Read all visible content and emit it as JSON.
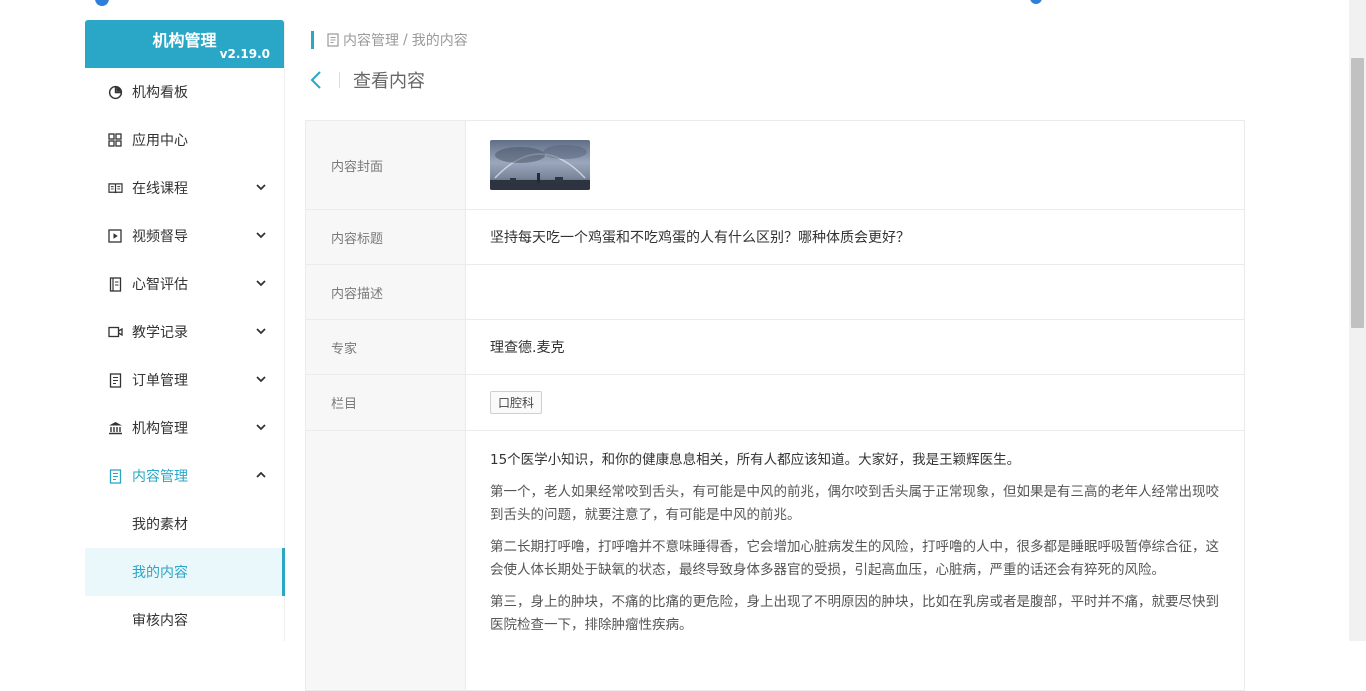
{
  "sidebar": {
    "brand_title": "机构管理",
    "brand_version": "v2.19.0",
    "items": [
      {
        "label": "机构看板",
        "icon": "pie-chart-icon",
        "has_children": false
      },
      {
        "label": "应用中心",
        "icon": "grid-icon",
        "has_children": false
      },
      {
        "label": "在线课程",
        "icon": "book-icon",
        "has_children": true
      },
      {
        "label": "视频督导",
        "icon": "play-icon",
        "has_children": true
      },
      {
        "label": "心智评估",
        "icon": "notebook-icon",
        "has_children": true
      },
      {
        "label": "教学记录",
        "icon": "video-camera-icon",
        "has_children": true
      },
      {
        "label": "订单管理",
        "icon": "document-icon",
        "has_children": true
      },
      {
        "label": "机构管理",
        "icon": "bank-icon",
        "has_children": true
      },
      {
        "label": "内容管理",
        "icon": "document-icon",
        "has_children": true,
        "expanded": true
      }
    ],
    "subitems": [
      {
        "label": "我的素材"
      },
      {
        "label": "我的内容",
        "selected": true
      },
      {
        "label": "审核内容"
      }
    ]
  },
  "breadcrumb": {
    "parent": "内容管理",
    "separator": "/",
    "current": "我的内容"
  },
  "page": {
    "title": "查看内容"
  },
  "detail": {
    "cover_label": "内容封面",
    "title_label": "内容标题",
    "title_value": "坚持每天吃一个鸡蛋和不吃鸡蛋的人有什么区别？哪种体质会更好？",
    "desc_label": "内容描述",
    "desc_value": "",
    "expert_label": "专家",
    "expert_value": "理查德.麦克",
    "column_label": "栏目",
    "column_tag": "口腔科",
    "paragraphs": [
      "15个医学小知识，和你的健康息息相关，所有人都应该知道。大家好，我是王颖辉医生。",
      "第一个，老人如果经常咬到舌头，有可能是中风的前兆，偶尔咬到舌头属于正常现象，但如果是有三高的老年人经常出现咬到舌头的问题，就要注意了，有可能是中风的前兆。",
      "第二长期打呼噜，打呼噜并不意味睡得香，它会增加心脏病发生的风险，打呼噜的人中，很多都是睡眠呼吸暂停综合征，这会使人体长期处于缺氧的状态，最终导致身体多器官的受损，引起高血压，心脏病，严重的话还会有猝死的风险。",
      "第三，身上的肿块，不痛的比痛的更危险，身上出现了不明原因的肿块，比如在乳房或者是腹部，平时并不痛，就要尽快到医院检查一下，排除肿瘤性疾病。"
    ]
  },
  "colors": {
    "accent": "#2aa7c6",
    "selected_bg": "#eaf7fb",
    "label_bg": "#f7f7f7"
  }
}
